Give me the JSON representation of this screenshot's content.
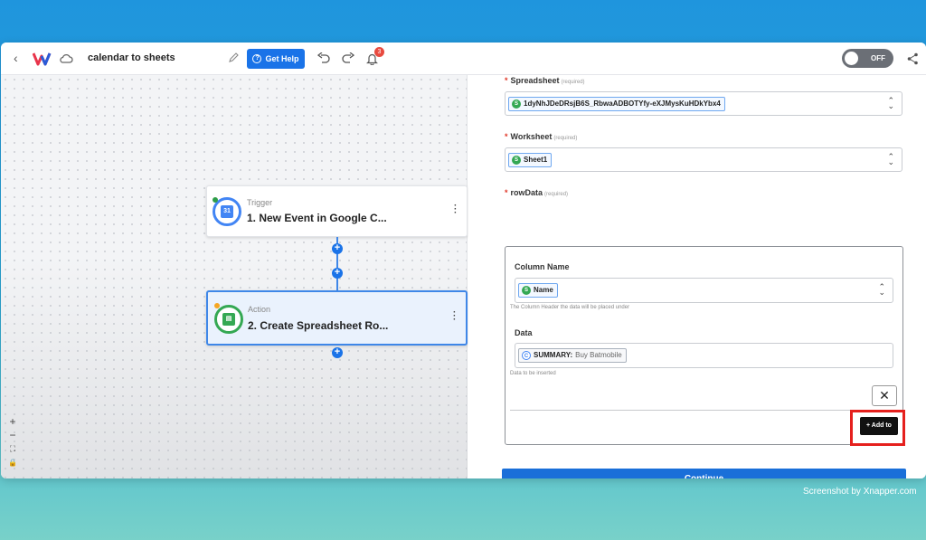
{
  "app": {
    "workflow_title": "calendar to sheets",
    "help_button": "Get Help",
    "notification_count": "3",
    "toggle_label": "OFF"
  },
  "canvas": {
    "nodes": [
      {
        "kind": "Trigger",
        "title": "1. New Event in Google C...",
        "icon_text": "31",
        "icon": "google-calendar-icon"
      },
      {
        "kind": "Action",
        "title": "2. Create Spreadsheet Ro...",
        "icon_text": "▤",
        "icon": "google-sheets-icon"
      }
    ],
    "zoom_controls": [
      "+",
      "−",
      "⛶",
      "🔒"
    ]
  },
  "panel": {
    "spreadsheet": {
      "label": "Spreadsheet",
      "required": "(required)",
      "value": "1dyNhJDeDRsjB6S_RbwaADBOTYfy-eXJMysKuHDkYbx4"
    },
    "worksheet": {
      "label": "Worksheet",
      "required": "(required)",
      "value": "Sheet1"
    },
    "rowdata": {
      "label": "rowData",
      "required": "(required)",
      "column_name_label": "Column Name",
      "column_name_value": "Name",
      "column_name_hint": "The Column Header the data will be placed under",
      "data_label": "Data",
      "data_key": "SUMMARY:",
      "data_value": "Buy Batmobile",
      "data_hint": "Data to be inserted",
      "remove_label": "✕",
      "add_label": "+ Add to"
    },
    "continue_label": "Continue"
  },
  "watermark": "Screenshot by Xnapper.com",
  "colors": {
    "accent": "#1a73e8",
    "highlight": "#e5201d",
    "background": "#2aa7d6"
  }
}
